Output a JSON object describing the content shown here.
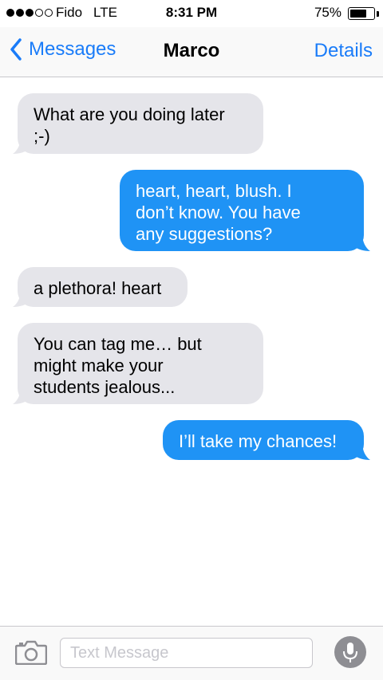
{
  "status_bar": {
    "signal_dots_filled": 3,
    "signal_dots_total": 5,
    "carrier": "Fido",
    "network": "LTE",
    "time": "8:31 PM",
    "battery_percent": "75%",
    "battery_level": 0.75
  },
  "nav": {
    "back_label": "Messages",
    "title": "Marco",
    "details_label": "Details",
    "back_icon": "chevron-left-icon"
  },
  "messages": [
    {
      "direction": "incoming",
      "lines": [
        "What are you doing later",
        ";-)"
      ]
    },
    {
      "direction": "outgoing",
      "lines": [
        "heart, heart, blush. I",
        "don’t know. You have",
        "any suggestions?"
      ]
    },
    {
      "direction": "incoming",
      "lines": [
        "a plethora! heart"
      ]
    },
    {
      "direction": "incoming",
      "lines": [
        "You can tag me… but",
        "might make your",
        "students jealous..."
      ]
    },
    {
      "direction": "outgoing",
      "lines": [
        "I’ll take my chances!"
      ]
    }
  ],
  "input": {
    "placeholder": "Text Message",
    "value": "",
    "camera_icon": "camera-icon",
    "mic_icon": "microphone-icon"
  },
  "colors": {
    "accent": "#1a7cf9",
    "outgoing_bubble": "#1f93f5",
    "incoming_bubble": "#e5e5ea",
    "mic_button": "#8e8e93"
  }
}
